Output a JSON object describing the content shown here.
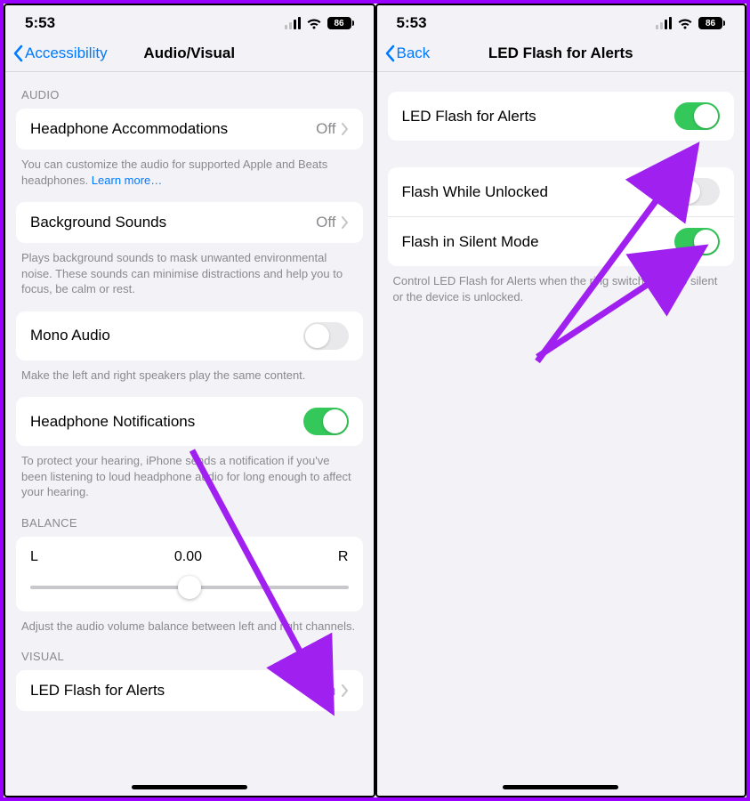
{
  "status": {
    "time": "5:53",
    "battery": "86"
  },
  "left": {
    "back": "Accessibility",
    "title": "Audio/Visual",
    "audio_header": "AUDIO",
    "visual_header": "VISUAL",
    "balance_header": "BALANCE",
    "rows": {
      "headphone": {
        "label": "Headphone Accommodations",
        "value": "Off"
      },
      "background": {
        "label": "Background Sounds",
        "value": "Off"
      },
      "mono": {
        "label": "Mono Audio"
      },
      "hp_notif": {
        "label": "Headphone Notifications"
      },
      "led": {
        "label": "LED Flash for Alerts",
        "value": "On"
      }
    },
    "notes": {
      "headphone": "You can customize the audio for supported Apple and Beats headphones. ",
      "learn": "Learn more…",
      "background": "Plays background sounds to mask unwanted environmental noise. These sounds can minimise distractions and help you to focus, be calm or rest.",
      "mono": "Make the left and right speakers play the same content.",
      "hp_notif": "To protect your hearing, iPhone sends a notification if you've been listening to loud headphone audio for long enough to affect your hearing.",
      "balance": "Adjust the audio volume balance between left and right channels."
    },
    "balance": {
      "left": "L",
      "value": "0.00",
      "right": "R"
    }
  },
  "right": {
    "back": "Back",
    "title": "LED Flash for Alerts",
    "rows": {
      "main": {
        "label": "LED Flash for Alerts"
      },
      "unlocked": {
        "label": "Flash While Unlocked"
      },
      "silent": {
        "label": "Flash in Silent Mode"
      }
    },
    "note": "Control LED Flash for Alerts when the ring switch is set to silent or the device is unlocked."
  }
}
